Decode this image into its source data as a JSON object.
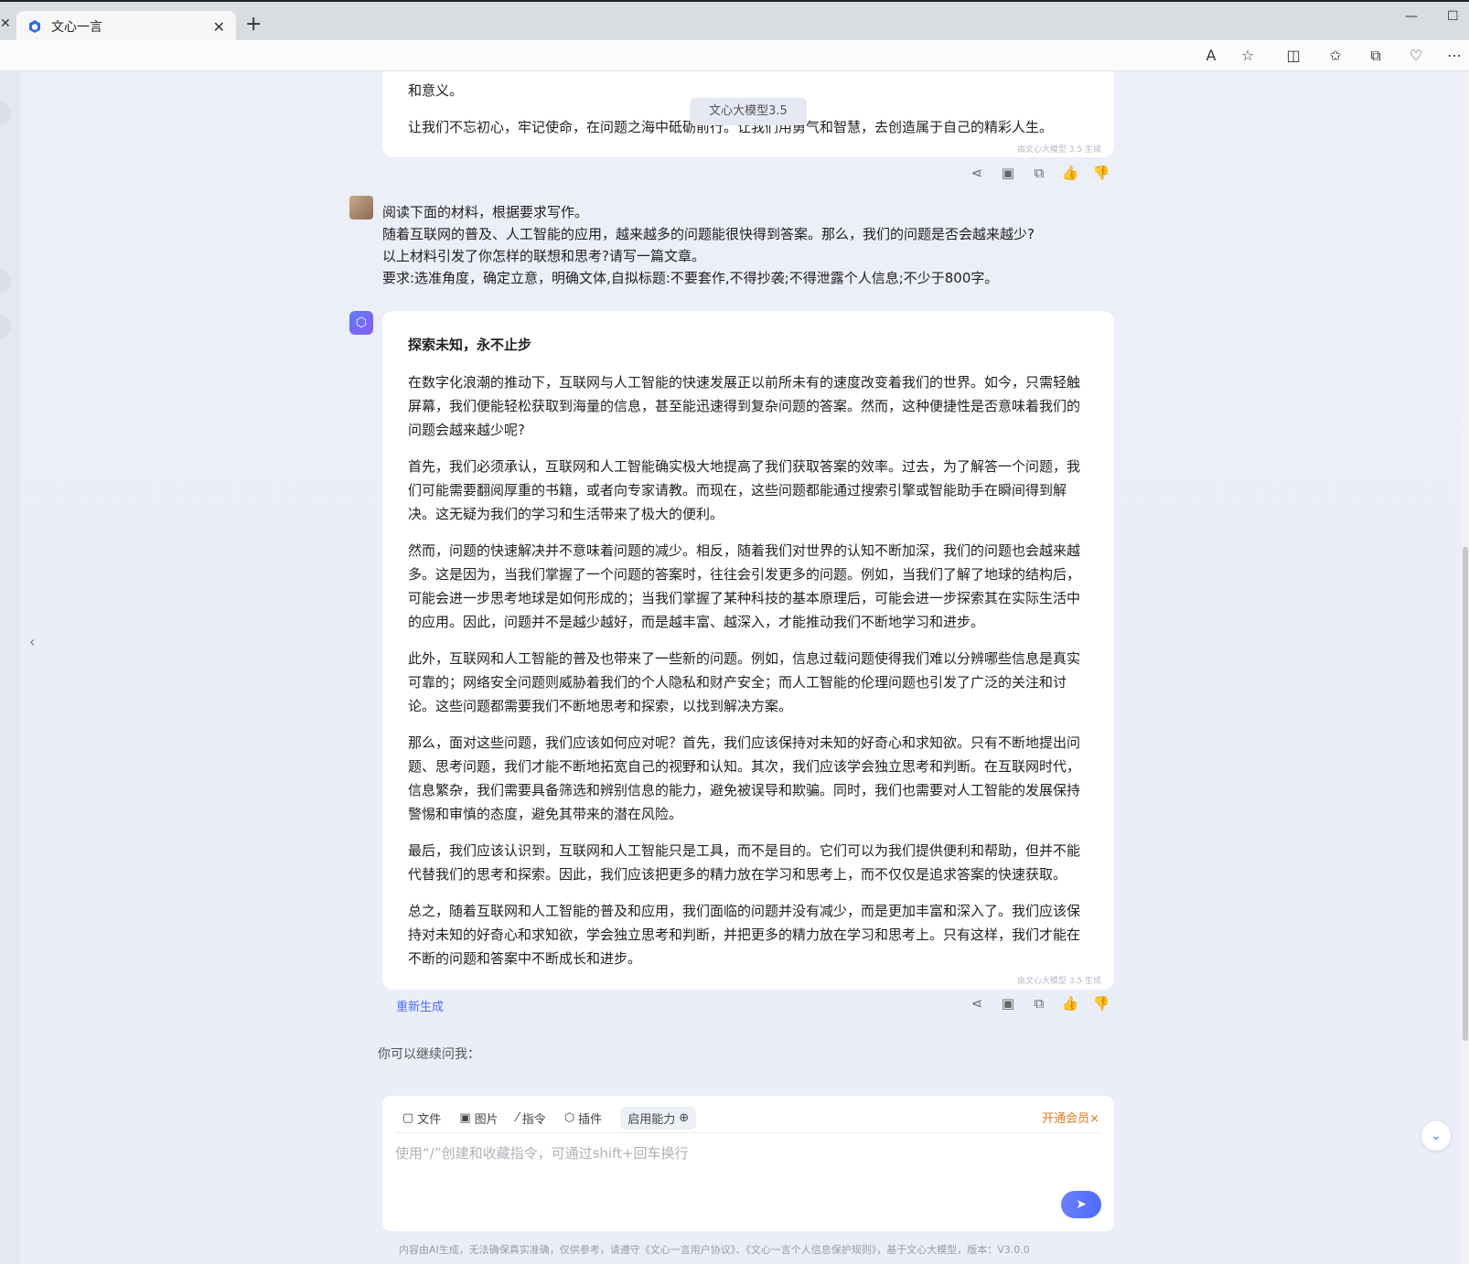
{
  "browser": {
    "tab_title": "文心一言",
    "new_tab_label": "+",
    "close_label": "✕"
  },
  "prev_answer": {
    "line1": "和意义。",
    "line2": "让我们不忘初心，牢记使命，在问题之海中砥砺前行。让我们用勇气和智慧，去创造属于自己的精彩人生。",
    "gen_note": "由文心大模型 3.5 生成"
  },
  "model_chip": "文心大模型3.5",
  "user_message": {
    "lines": [
      "阅读下面的材料，根据要求写作。",
      "随着互联网的普及、人工智能的应用，越来越多的问题能很快得到答案。那么，我们的问题是否会越来越少?",
      "以上材料引发了你怎样的联想和思考?请写一篇文章。",
      "要求:选准角度，确定立意，明确文体,自拟标题:不要套作,不得抄袭;不得泄露个人信息;不少于800字。"
    ]
  },
  "answer": {
    "title": "探索未知，永不止步",
    "paragraphs": [
      "在数字化浪潮的推动下，互联网与人工智能的快速发展正以前所未有的速度改变着我们的世界。如今，只需轻触屏幕，我们便能轻松获取到海量的信息，甚至能迅速得到复杂问题的答案。然而，这种便捷性是否意味着我们的问题会越来越少呢?",
      "首先，我们必须承认，互联网和人工智能确实极大地提高了我们获取答案的效率。过去，为了解答一个问题，我们可能需要翻阅厚重的书籍，或者向专家请教。而现在，这些问题都能通过搜索引擎或智能助手在瞬间得到解决。这无疑为我们的学习和生活带来了极大的便利。",
      "然而，问题的快速解决并不意味着问题的减少。相反，随着我们对世界的认知不断加深，我们的问题也会越来越多。这是因为，当我们掌握了一个问题的答案时，往往会引发更多的问题。例如，当我们了解了地球的结构后，可能会进一步思考地球是如何形成的；当我们掌握了某种科技的基本原理后，可能会进一步探索其在实际生活中的应用。因此，问题并不是越少越好，而是越丰富、越深入，才能推动我们不断地学习和进步。",
      "此外，互联网和人工智能的普及也带来了一些新的问题。例如，信息过载问题使得我们难以分辨哪些信息是真实可靠的；网络安全问题则威胁着我们的个人隐私和财产安全；而人工智能的伦理问题也引发了广泛的关注和讨论。这些问题都需要我们不断地思考和探索，以找到解决方案。",
      "那么，面对这些问题，我们应该如何应对呢？首先，我们应该保持对未知的好奇心和求知欲。只有不断地提出问题、思考问题，我们才能不断地拓宽自己的视野和认知。其次，我们应该学会独立思考和判断。在互联网时代，信息繁杂，我们需要具备筛选和辨别信息的能力，避免被误导和欺骗。同时，我们也需要对人工智能的发展保持警惕和审慎的态度，避免其带来的潜在风险。",
      "最后，我们应该认识到，互联网和人工智能只是工具，而不是目的。它们可以为我们提供便利和帮助，但并不能代替我们的思考和探索。因此，我们应该把更多的精力放在学习和思考上，而不仅仅是追求答案的快速获取。",
      "总之，随着互联网和人工智能的普及和应用，我们面临的问题并没有减少，而是更加丰富和深入了。我们应该保持对未知的好奇心和求知欲，学会独立思考和判断，并把更多的精力放在学习和思考上。只有这样，我们才能在不断的问题和答案中不断成长和进步。"
    ],
    "gen_note": "由文心大模型 3.5 生成",
    "regenerate": "重新生成"
  },
  "continue_label": "你可以继续问我：",
  "input": {
    "tools": [
      "文件",
      "图片",
      "指令",
      "插件"
    ],
    "ability": "启用能力",
    "vip": "开通会员",
    "placeholder": "使用“/”创建和收藏指令，可通过shift+回车换行"
  },
  "footer": "内容由AI生成，无法确保真实准确，仅供参考，请遵守《文心一言用户协议》、《文心一言个人信息保护规则》，基于文心大模型，版本：V3.0.0"
}
